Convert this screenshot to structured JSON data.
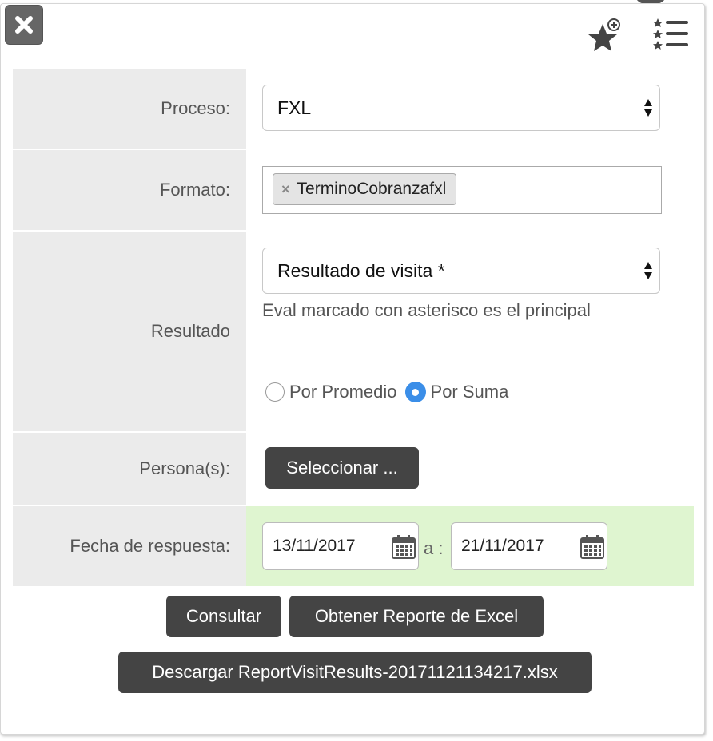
{
  "header": {
    "close_icon": "close-icon",
    "favorite_icon": "star-plus-icon",
    "list_icon": "star-list-icon"
  },
  "form": {
    "proceso": {
      "label": "Proceso:",
      "value": "FXL"
    },
    "formato": {
      "label": "Formato:",
      "tag": "TerminoCobranzafxl",
      "tag_remove": "×"
    },
    "resultado": {
      "label": "Resultado",
      "value": "Resultado de visita *",
      "hint": "Eval marcado con asterisco es el principal",
      "options": [
        {
          "label": "Por Promedio",
          "selected": false
        },
        {
          "label": "Por Suma",
          "selected": true
        }
      ]
    },
    "personas": {
      "label": "Persona(s):",
      "button": "Seleccionar ..."
    },
    "fecha": {
      "label": "Fecha de respuesta:",
      "from": "13/11/2017",
      "separator": "a :",
      "to": "21/11/2017"
    }
  },
  "actions": {
    "consultar": "Consultar",
    "excel": "Obtener Reporte de Excel",
    "download": "Descargar ReportVisitResults-20171121134217.xlsx"
  },
  "colors": {
    "accent": "#3b8ee8",
    "button": "#444444",
    "label_bg": "#ebebeb",
    "date_bg": "#dff5d0"
  }
}
